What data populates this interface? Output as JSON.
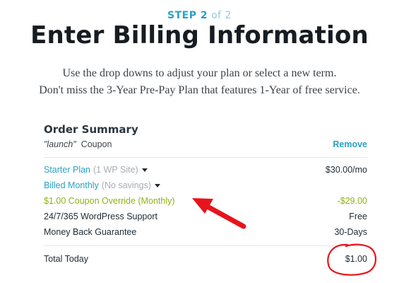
{
  "header": {
    "step_label": "STEP 2",
    "step_total": "of 2",
    "title": "Enter Billing Information",
    "intro_line1": "Use the drop downs to adjust your plan or select a new term.",
    "intro_line2": "Don't miss the 3-Year Pre-Pay Plan that features 1-Year of free service."
  },
  "summary": {
    "title": "Order Summary",
    "coupon_code": "\"launch\"",
    "coupon_word": "Coupon",
    "remove_label": "Remove",
    "plan": {
      "name": "Starter Plan",
      "detail": "(1 WP Site)",
      "price": "$30.00/mo"
    },
    "term": {
      "name": "Billed Monthly",
      "detail": "(No savings)"
    },
    "coupon_override": {
      "label": "$1.00 Coupon Override (Monthly)",
      "value": "-$29.00"
    },
    "support": {
      "label": "24/7/365 WordPress Support",
      "value": "Free"
    },
    "guarantee": {
      "label": "Money Back Guarantee",
      "value": "30-Days"
    },
    "total": {
      "label": "Total Today",
      "value": "$1.00"
    }
  },
  "colors": {
    "accent": "#2aa0c4",
    "green": "#8cb317",
    "annotation": "#e8141c"
  },
  "icons": [
    "caret-down-icon",
    "red-arrow-annotation",
    "red-circle-annotation"
  ]
}
